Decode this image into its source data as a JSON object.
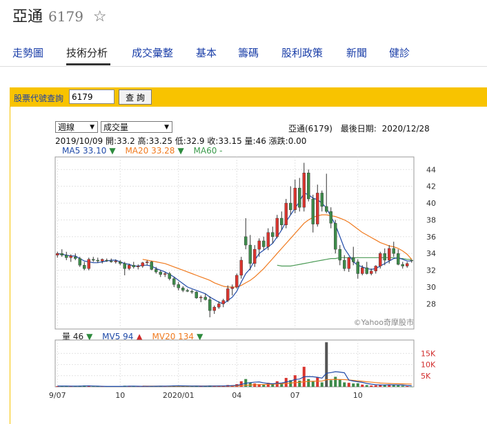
{
  "header": {
    "name": "亞通",
    "code": "6179",
    "star": "☆"
  },
  "tabs": [
    {
      "label": "走勢圖"
    },
    {
      "label": "技術分析"
    },
    {
      "label": "成交彙整"
    },
    {
      "label": "基本"
    },
    {
      "label": "籌碼"
    },
    {
      "label": "股利政策"
    },
    {
      "label": "新聞"
    },
    {
      "label": "健診"
    }
  ],
  "query": {
    "label": "股票代號查詢",
    "value": "6179",
    "button": "查 詢"
  },
  "controls": {
    "period": "週線",
    "indicator": "成交量"
  },
  "info": {
    "stock": "亞通(6179)",
    "last_date_label": "最後日期:",
    "last_date": "2020/12/28",
    "ohlc_line": "2019/10/09  開:33.2  高:33.25  低:32.9  收:33.15  量:46  漲跌:0.00"
  },
  "ma_legend": [
    {
      "label": "MA5 33.10",
      "arrow": "▼",
      "color": "#1f4aa8",
      "arrow_color": "#2e8b3e"
    },
    {
      "label": "MA20 33.28",
      "arrow": "▼",
      "color": "#f07a1e",
      "arrow_color": "#2e8b3e"
    },
    {
      "label": "MA60 -",
      "arrow": "",
      "color": "#3a9a4a",
      "arrow_color": "#3a9a4a"
    }
  ],
  "vol_legend": [
    {
      "label": "量 46",
      "arrow": "▼",
      "color": "#222",
      "arrow_color": "#2e8b3e"
    },
    {
      "label": "MV5 94",
      "arrow": "▲",
      "color": "#1f4aa8",
      "arrow_color": "#d12b2b"
    },
    {
      "label": "MV20 134",
      "arrow": "▼",
      "color": "#f07a1e",
      "arrow_color": "#2e8b3e"
    }
  ],
  "colors": {
    "up": "#d9352f",
    "down": "#3d8a4a",
    "ma5": "#1f4aa8",
    "ma20": "#f07a1e",
    "ma60": "#4a9a55",
    "accent": "#f8c300"
  },
  "chart_data": {
    "type": "candlestick",
    "price_axis": {
      "ylim": [
        25,
        45.5
      ],
      "ticks": [
        28,
        30,
        32,
        34,
        36,
        38,
        40,
        42,
        44
      ]
    },
    "volume_axis": {
      "ylim": [
        0,
        21000
      ],
      "tick_labels": [
        "15K",
        "10K",
        "5K"
      ],
      "tick_values": [
        15000,
        10000,
        5000
      ]
    },
    "x_ticks": [
      {
        "label": "9/07",
        "index": 0
      },
      {
        "label": "10",
        "index": 14
      },
      {
        "label": "2020/01",
        "index": 27
      },
      {
        "label": "04",
        "index": 40
      },
      {
        "label": "07",
        "index": 53
      },
      {
        "label": "10",
        "index": 67
      }
    ],
    "watermark": "©Yahoo奇摩股市",
    "candles": [
      [
        33.8,
        34.2,
        33.5,
        34.0,
        300
      ],
      [
        34.0,
        34.5,
        33.6,
        33.8,
        250
      ],
      [
        33.8,
        34.2,
        33.2,
        33.5,
        400
      ],
      [
        33.5,
        33.9,
        33.0,
        33.7,
        300
      ],
      [
        33.6,
        34.0,
        33.2,
        33.4,
        200
      ],
      [
        33.4,
        33.6,
        32.4,
        32.6,
        500
      ],
      [
        32.6,
        33.0,
        32.0,
        32.2,
        600
      ],
      [
        32.2,
        33.5,
        32.0,
        33.3,
        450
      ],
      [
        33.3,
        33.6,
        33.0,
        33.2,
        200
      ],
      [
        33.2,
        33.5,
        32.9,
        33.1,
        150
      ],
      [
        33.1,
        33.4,
        32.8,
        33.3,
        200
      ],
      [
        33.2,
        33.4,
        33.0,
        33.15,
        150
      ],
      [
        33.1,
        33.4,
        32.9,
        33.0,
        150
      ],
      [
        33.0,
        33.3,
        32.8,
        33.1,
        200
      ],
      [
        33.0,
        33.2,
        32.6,
        32.8,
        250
      ],
      [
        32.8,
        33.0,
        31.4,
        32.2,
        500
      ],
      [
        32.2,
        32.8,
        32.0,
        32.6,
        300
      ],
      [
        32.6,
        33.0,
        32.2,
        32.4,
        200
      ],
      [
        32.4,
        32.7,
        32.1,
        32.5,
        200
      ],
      [
        32.5,
        33.0,
        32.3,
        32.9,
        250
      ],
      [
        32.9,
        33.2,
        32.6,
        33.0,
        200
      ],
      [
        33.0,
        33.1,
        32.0,
        32.1,
        300
      ],
      [
        32.1,
        32.4,
        31.6,
        31.8,
        400
      ],
      [
        31.8,
        32.0,
        31.2,
        31.5,
        350
      ],
      [
        31.5,
        31.8,
        31.2,
        31.6,
        250
      ],
      [
        31.6,
        31.8,
        30.8,
        31.0,
        450
      ],
      [
        31.0,
        31.2,
        30.0,
        30.3,
        600
      ],
      [
        30.3,
        30.6,
        29.6,
        29.9,
        500
      ],
      [
        29.9,
        30.1,
        29.4,
        29.6,
        300
      ],
      [
        29.6,
        29.8,
        29.4,
        29.5,
        200
      ],
      [
        29.5,
        29.7,
        29.2,
        29.4,
        250
      ],
      [
        29.4,
        29.5,
        28.6,
        28.7,
        350
      ],
      [
        28.7,
        29.0,
        28.2,
        28.8,
        300
      ],
      [
        28.8,
        29.2,
        28.4,
        28.5,
        200
      ],
      [
        28.5,
        28.9,
        26.4,
        27.2,
        600
      ],
      [
        27.2,
        27.8,
        26.8,
        27.6,
        500
      ],
      [
        27.6,
        28.3,
        27.4,
        28.0,
        400
      ],
      [
        28.0,
        28.6,
        27.6,
        28.4,
        350
      ],
      [
        28.4,
        30.2,
        28.2,
        29.8,
        800
      ],
      [
        29.8,
        30.3,
        29.0,
        30.0,
        700
      ],
      [
        30.0,
        31.6,
        29.8,
        31.4,
        1200
      ],
      [
        31.4,
        33.6,
        31.0,
        33.2,
        2500
      ],
      [
        36.0,
        38.2,
        34.5,
        35.0,
        3500
      ],
      [
        35.0,
        36.2,
        32.0,
        32.8,
        2000
      ],
      [
        32.8,
        35.0,
        32.4,
        34.5,
        1500
      ],
      [
        34.5,
        35.8,
        33.6,
        35.5,
        1200
      ],
      [
        35.5,
        36.0,
        34.4,
        34.8,
        900
      ],
      [
        34.8,
        37.0,
        34.4,
        36.5,
        1800
      ],
      [
        36.5,
        37.2,
        35.2,
        36.0,
        1300
      ],
      [
        36.0,
        38.6,
        35.8,
        38.2,
        2500
      ],
      [
        38.2,
        39.0,
        36.8,
        37.4,
        1800
      ],
      [
        37.4,
        40.5,
        37.0,
        40.0,
        4000
      ],
      [
        40.0,
        42.0,
        38.6,
        39.2,
        3000
      ],
      [
        39.2,
        42.8,
        38.8,
        41.8,
        5200
      ],
      [
        41.8,
        43.0,
        39.0,
        39.5,
        2800
      ],
      [
        39.5,
        44.8,
        39.0,
        43.6,
        9000
      ],
      [
        43.6,
        44.0,
        40.2,
        40.5,
        3500
      ],
      [
        40.5,
        41.0,
        36.5,
        37.5,
        2500
      ],
      [
        37.5,
        42.2,
        37.2,
        41.2,
        4200
      ],
      [
        41.2,
        41.5,
        39.0,
        39.6,
        2000
      ],
      [
        39.6,
        43.5,
        38.8,
        39.0,
        20000
      ],
      [
        39.0,
        39.5,
        37.0,
        37.6,
        3000
      ],
      [
        37.6,
        38.0,
        34.0,
        34.5,
        4500
      ],
      [
        34.5,
        35.0,
        32.6,
        33.2,
        3200
      ],
      [
        33.2,
        33.8,
        31.9,
        32.2,
        2000
      ],
      [
        32.2,
        33.6,
        31.8,
        33.5,
        1800
      ],
      [
        33.5,
        34.8,
        32.6,
        33.0,
        1500
      ],
      [
        33.0,
        33.3,
        31.0,
        31.6,
        1600
      ],
      [
        31.6,
        32.6,
        31.4,
        32.3,
        1000
      ],
      [
        32.3,
        33.0,
        31.5,
        31.6,
        800
      ],
      [
        31.6,
        32.2,
        31.4,
        31.9,
        600
      ],
      [
        31.9,
        32.6,
        31.6,
        32.5,
        700
      ],
      [
        32.5,
        34.2,
        32.2,
        34.0,
        1000
      ],
      [
        34.0,
        34.6,
        32.6,
        33.2,
        900
      ],
      [
        33.2,
        35.0,
        32.8,
        34.6,
        1100
      ],
      [
        34.6,
        35.4,
        33.6,
        34.0,
        800
      ],
      [
        34.0,
        34.5,
        32.6,
        32.7,
        700
      ],
      [
        32.7,
        33.0,
        32.2,
        32.5,
        500
      ],
      [
        32.5,
        33.0,
        32.3,
        32.8,
        300
      ],
      [
        33.2,
        33.25,
        32.9,
        33.15,
        46
      ]
    ],
    "ma5": [
      34.0,
      33.9,
      33.8,
      33.7,
      33.7,
      33.4,
      33.1,
      33.0,
      32.9,
      32.9,
      33.0,
      33.1,
      33.2,
      33.2,
      33.0,
      32.8,
      32.7,
      32.5,
      32.5,
      32.6,
      32.6,
      32.5,
      32.2,
      32.0,
      31.8,
      31.5,
      31.2,
      30.8,
      30.4,
      30.0,
      29.8,
      29.6,
      29.4,
      29.2,
      28.8,
      28.5,
      28.2,
      28.0,
      28.4,
      28.8,
      29.5,
      30.6,
      31.6,
      32.2,
      33.2,
      34.0,
      34.4,
      34.8,
      35.2,
      36.0,
      36.8,
      37.8,
      38.6,
      39.4,
      40.2,
      41.2,
      41.0,
      40.6,
      40.4,
      40.0,
      39.4,
      38.4,
      37.4,
      36.0,
      34.6,
      33.8,
      33.0,
      32.6,
      32.4,
      32.2,
      32.1,
      32.2,
      32.5,
      32.8,
      33.1,
      33.4,
      33.5,
      33.3,
      33.1,
      33.1
    ],
    "ma20": [
      null,
      null,
      null,
      null,
      null,
      null,
      null,
      null,
      null,
      null,
      null,
      null,
      null,
      null,
      null,
      null,
      null,
      null,
      null,
      33.3,
      33.2,
      33.1,
      33.0,
      32.9,
      32.8,
      32.6,
      32.4,
      32.2,
      32.0,
      31.8,
      31.6,
      31.4,
      31.2,
      31.0,
      30.8,
      30.5,
      30.3,
      30.1,
      30.0,
      30.0,
      30.0,
      30.2,
      30.5,
      30.8,
      31.2,
      31.7,
      32.2,
      32.8,
      33.4,
      34.0,
      34.6,
      35.2,
      35.8,
      36.4,
      37.0,
      37.6,
      38.0,
      38.3,
      38.5,
      38.6,
      38.6,
      38.5,
      38.4,
      38.2,
      38.0,
      37.7,
      37.3,
      36.9,
      36.5,
      36.2,
      35.9,
      35.6,
      35.3,
      35.1,
      34.9,
      34.8,
      34.6,
      34.3,
      33.9,
      33.3
    ],
    "ma60": [
      null,
      null,
      null,
      null,
      null,
      null,
      null,
      null,
      null,
      null,
      null,
      null,
      null,
      null,
      null,
      null,
      null,
      null,
      null,
      null,
      null,
      null,
      null,
      null,
      null,
      null,
      null,
      null,
      null,
      null,
      null,
      null,
      null,
      null,
      null,
      null,
      null,
      null,
      null,
      null,
      null,
      null,
      null,
      null,
      null,
      null,
      null,
      null,
      null,
      32.6,
      32.5,
      32.5,
      32.5,
      32.6,
      32.7,
      32.8,
      32.9,
      33.0,
      33.1,
      33.2,
      33.3,
      33.4,
      33.4,
      33.5,
      33.5,
      33.5,
      33.5,
      33.5,
      33.5,
      33.5,
      33.5,
      33.5,
      33.5,
      33.5,
      33.5,
      33.5,
      33.4,
      33.4,
      33.3,
      33.3
    ],
    "mv5": [
      350,
      330,
      340,
      320,
      310,
      320,
      400,
      430,
      380,
      300,
      250,
      200,
      170,
      180,
      190,
      260,
      300,
      300,
      290,
      260,
      240,
      260,
      290,
      300,
      310,
      360,
      420,
      450,
      430,
      410,
      350,
      330,
      300,
      300,
      330,
      380,
      410,
      410,
      470,
      560,
      670,
      1100,
      1600,
      1900,
      2100,
      2200,
      1800,
      1500,
      1400,
      1600,
      1700,
      2200,
      2600,
      3300,
      3500,
      4500,
      4600,
      4500,
      4300,
      3900,
      6100,
      6400,
      6800,
      6600,
      6300,
      3000,
      2600,
      2300,
      2000,
      1500,
      1200,
      1000,
      800,
      850,
      900,
      900,
      860,
      800,
      600,
      460
    ],
    "mv20": [
      null,
      null,
      null,
      null,
      null,
      null,
      null,
      null,
      null,
      null,
      null,
      null,
      null,
      null,
      null,
      null,
      null,
      null,
      null,
      330,
      320,
      310,
      300,
      300,
      290,
      290,
      300,
      310,
      320,
      320,
      320,
      330,
      330,
      330,
      340,
      350,
      370,
      380,
      400,
      430,
      470,
      560,
      700,
      800,
      900,
      1000,
      1050,
      1100,
      1200,
      1300,
      1400,
      1550,
      1700,
      1900,
      2050,
      2300,
      2400,
      2500,
      2550,
      2550,
      3200,
      3300,
      3350,
      3300,
      3250,
      3100,
      2900,
      2700,
      2500,
      2300,
      2100,
      1900,
      1700,
      1600,
      1500,
      1450,
      1400,
      1350,
      1300,
      1250
    ]
  }
}
